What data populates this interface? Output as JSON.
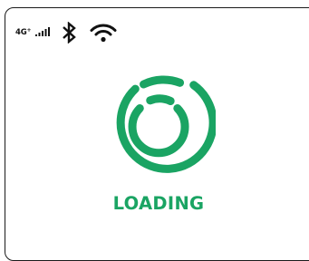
{
  "status_bar": {
    "network_type": "4G",
    "network_superscript": "+",
    "signal_icon": "signal-bars-icon",
    "bluetooth_icon": "bluetooth-icon",
    "wifi_icon": "wifi-icon"
  },
  "loading": {
    "spinner_icon": "circular-loading-spinner-icon",
    "label": "LOADING"
  },
  "colors": {
    "accent": "#1aa463",
    "icon": "#111111",
    "frame": "#1a1a1a",
    "background": "#ffffff"
  }
}
